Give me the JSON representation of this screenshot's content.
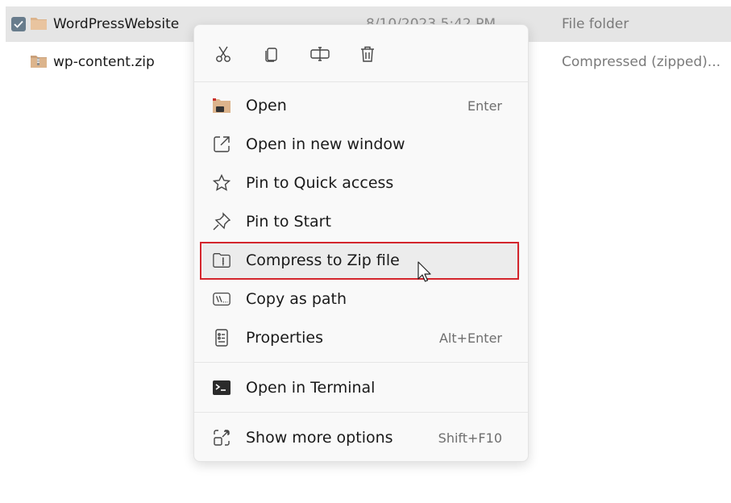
{
  "files": [
    {
      "name": "WordPressWebsite",
      "date": "8/10/2023 5:42 PM",
      "type": "File folder",
      "selected": true,
      "icon": "folder-icon"
    },
    {
      "name": "wp-content.zip",
      "date": "",
      "type": "Compressed (zipped)...",
      "selected": false,
      "icon": "zip-folder-icon"
    }
  ],
  "toolbar": {
    "cut": "cut-icon",
    "copy": "copy-icon",
    "rename": "rename-icon",
    "delete": "delete-icon"
  },
  "menu": {
    "items": [
      {
        "label": "Open",
        "shortcut": "Enter",
        "icon": "folder-open-icon"
      },
      {
        "label": "Open in new window",
        "shortcut": "",
        "icon": "external-window-icon"
      },
      {
        "label": "Pin to Quick access",
        "shortcut": "",
        "icon": "star-icon"
      },
      {
        "label": "Pin to Start",
        "shortcut": "",
        "icon": "pin-icon"
      },
      {
        "label": "Compress to Zip file",
        "shortcut": "",
        "icon": "zip-icon"
      },
      {
        "label": "Copy as path",
        "shortcut": "",
        "icon": "path-icon"
      },
      {
        "label": "Properties",
        "shortcut": "Alt+Enter",
        "icon": "properties-icon"
      },
      {
        "label": "Open in Terminal",
        "shortcut": "",
        "icon": "terminal-icon"
      },
      {
        "label": "Show more options",
        "shortcut": "Shift+F10",
        "icon": "more-options-icon"
      }
    ]
  },
  "colors": {
    "highlight_border": "#d3252c",
    "selected_row": "#e5e5e5",
    "folder": "#dcb48c"
  }
}
